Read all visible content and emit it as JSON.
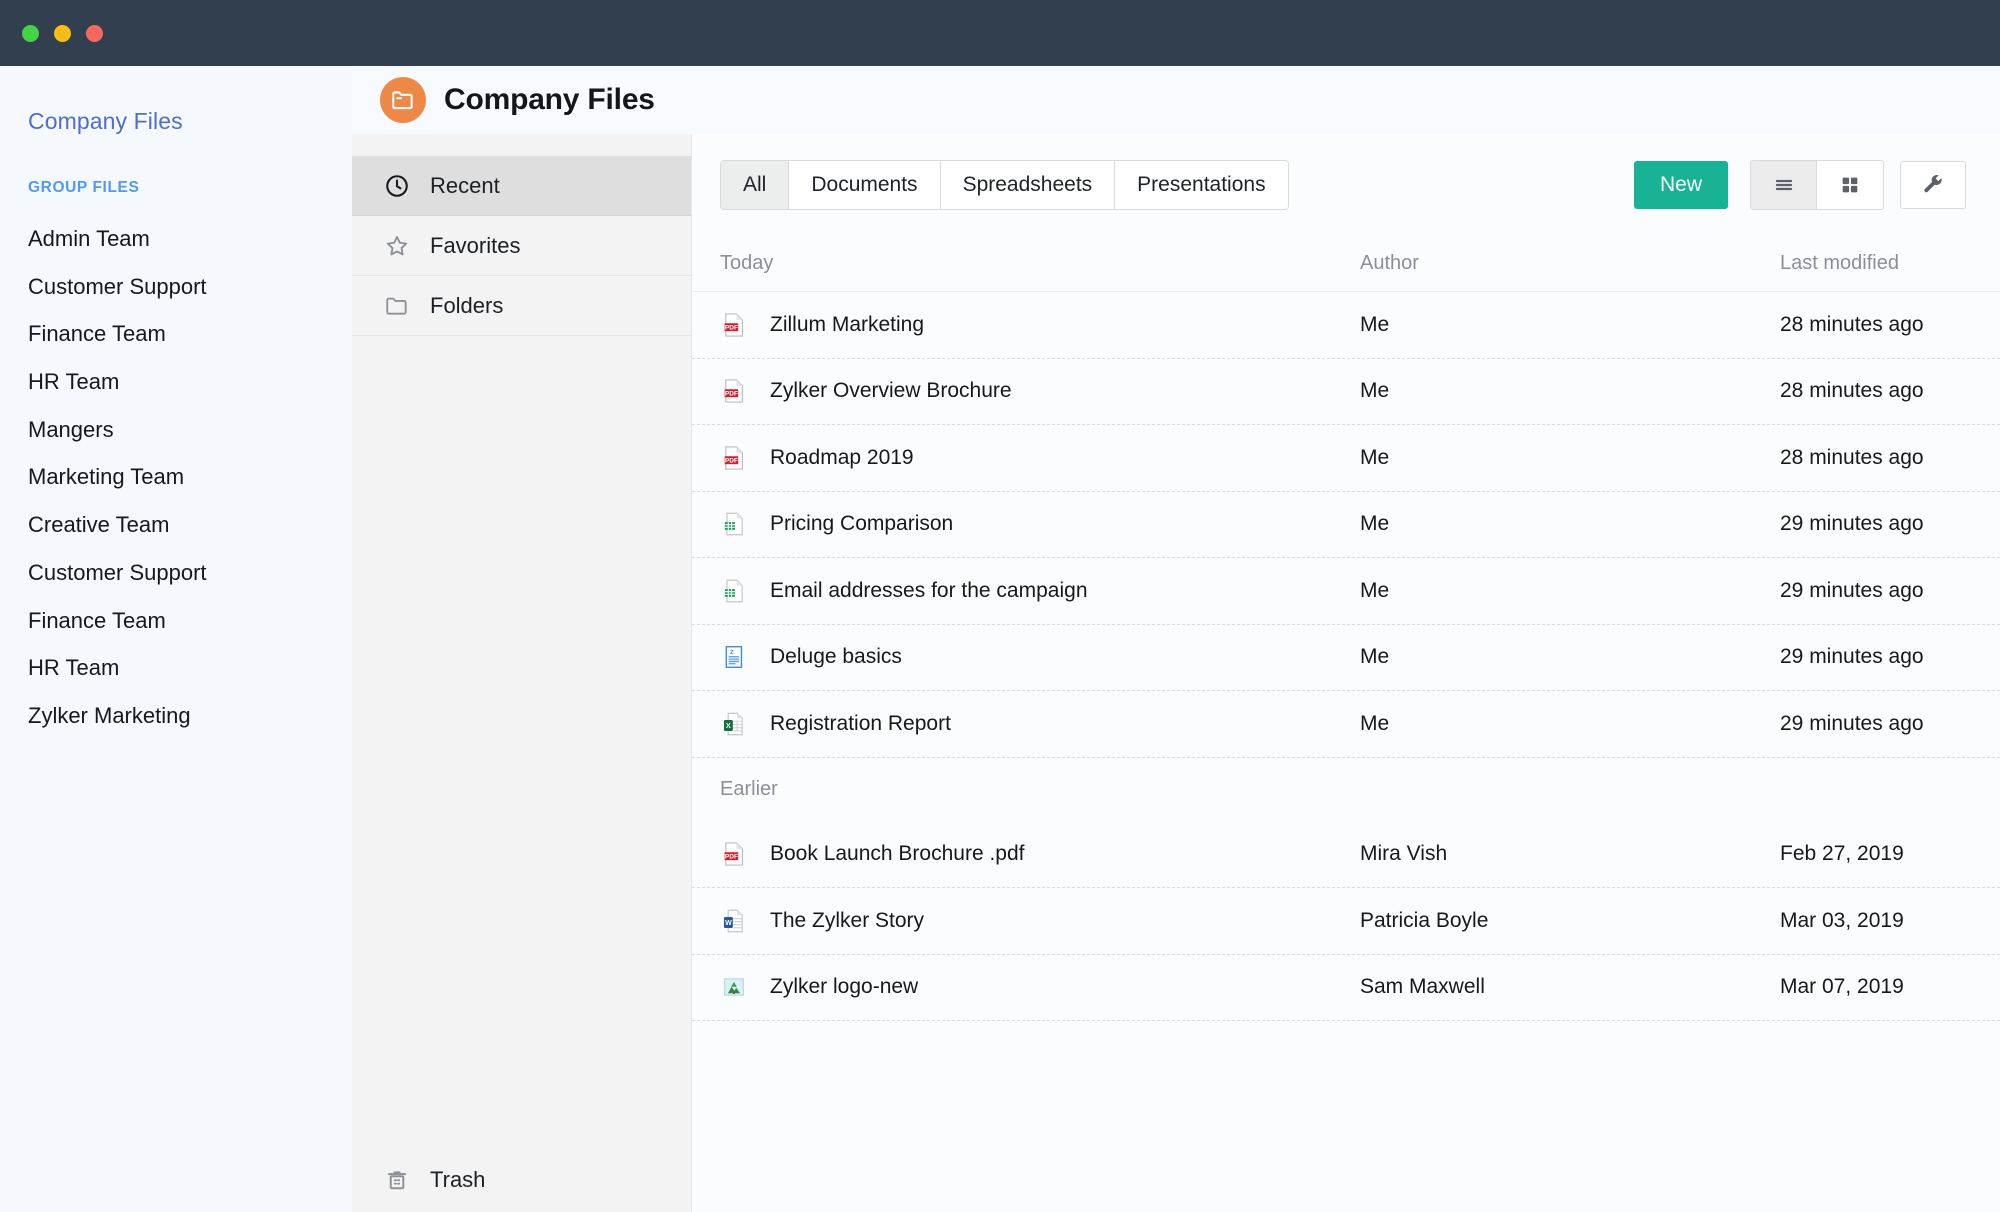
{
  "window": {
    "traffic_lights": [
      {
        "name": "close-dot",
        "color": "#45d14a"
      },
      {
        "name": "minimize-dot",
        "color": "#f9bc15"
      },
      {
        "name": "maximize-dot",
        "color": "#f6685e"
      }
    ],
    "titlebar_color": "#313f4f"
  },
  "sidebar": {
    "title": "Company Files",
    "group_label": "GROUP FILES",
    "items": [
      {
        "label": "Admin Team"
      },
      {
        "label": "Customer Support"
      },
      {
        "label": "Finance Team"
      },
      {
        "label": "HR Team"
      },
      {
        "label": "Mangers"
      },
      {
        "label": "Marketing Team"
      },
      {
        "label": "Creative Team"
      },
      {
        "label": "Customer Support"
      },
      {
        "label": "Finance Team"
      },
      {
        "label": "HR Team"
      },
      {
        "label": "Zylker Marketing"
      }
    ]
  },
  "header": {
    "title": "Company Files",
    "logo_icon": "folder-icon",
    "logo_color": "#ee8846"
  },
  "navpane": {
    "items": [
      {
        "label": "Recent",
        "icon": "clock-icon",
        "active": true
      },
      {
        "label": "Favorites",
        "icon": "star-icon",
        "active": false
      },
      {
        "label": "Folders",
        "icon": "folder-outline-icon",
        "active": false
      }
    ],
    "trash": {
      "label": "Trash",
      "icon": "trash-icon"
    }
  },
  "toolbar": {
    "tabs": [
      {
        "label": "All",
        "active": true
      },
      {
        "label": "Documents",
        "active": false
      },
      {
        "label": "Spreadsheets",
        "active": false
      },
      {
        "label": "Presentations",
        "active": false
      }
    ],
    "new_button": {
      "label": "New",
      "color": "#18b394"
    },
    "view_buttons": [
      {
        "name": "list-view-icon",
        "active": true
      },
      {
        "name": "grid-view-icon",
        "active": false
      }
    ],
    "settings_button": {
      "name": "wrench-icon"
    }
  },
  "table": {
    "columns": {
      "name": "Today",
      "author": "Author",
      "modified": "Last modified"
    },
    "groups": [
      {
        "label": "Today",
        "is_header_row": true,
        "rows": [
          {
            "name": "Zillum Marketing",
            "icon": "pdf-icon",
            "author": "Me",
            "modified": "28 minutes ago"
          },
          {
            "name": "Zylker Overview Brochure",
            "icon": "pdf-icon",
            "author": "Me",
            "modified": "28 minutes ago"
          },
          {
            "name": "Roadmap 2019",
            "icon": "pdf-icon",
            "author": "Me",
            "modified": "28 minutes ago"
          },
          {
            "name": "Pricing Comparison",
            "icon": "sheet-icon",
            "author": "Me",
            "modified": "29 minutes ago"
          },
          {
            "name": "Email addresses for the campaign",
            "icon": "sheet-icon",
            "author": "Me",
            "modified": "29 minutes ago"
          },
          {
            "name": "Deluge basics",
            "icon": "writer-icon",
            "author": "Me",
            "modified": "29 minutes ago"
          },
          {
            "name": "Registration Report",
            "icon": "excel-icon",
            "author": "Me",
            "modified": "29 minutes ago"
          }
        ]
      },
      {
        "label": "Earlier",
        "is_header_row": false,
        "rows": [
          {
            "name": "Book Launch Brochure .pdf",
            "icon": "pdf-icon",
            "author": "Mira Vish",
            "modified": "Feb 27, 2019"
          },
          {
            "name": "The Zylker Story",
            "icon": "word-icon",
            "author": "Patricia Boyle",
            "modified": "Mar 03, 2019"
          },
          {
            "name": "Zylker logo-new",
            "icon": "image-icon",
            "author": "Sam Maxwell",
            "modified": "Mar 07, 2019"
          }
        ]
      }
    ]
  }
}
